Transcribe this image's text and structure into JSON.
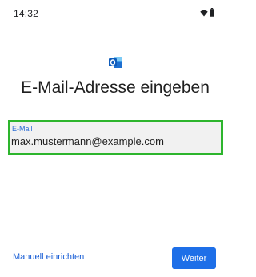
{
  "status_bar": {
    "time": "14:32"
  },
  "icons": {
    "wifi": "wifi-icon",
    "battery": "battery-icon",
    "app_logo": "outlook-logo-icon"
  },
  "page": {
    "title": "E-Mail-Adresse eingeben"
  },
  "email_field": {
    "label": "E-Mail",
    "value": "max.mustermann@example.com",
    "highlight_color": "#2db52d",
    "label_color": "#2f6fd6"
  },
  "footer": {
    "manual_setup_label": "Manuell einrichten",
    "next_button_label": "Weiter",
    "accent_color": "#1e6fe8"
  }
}
